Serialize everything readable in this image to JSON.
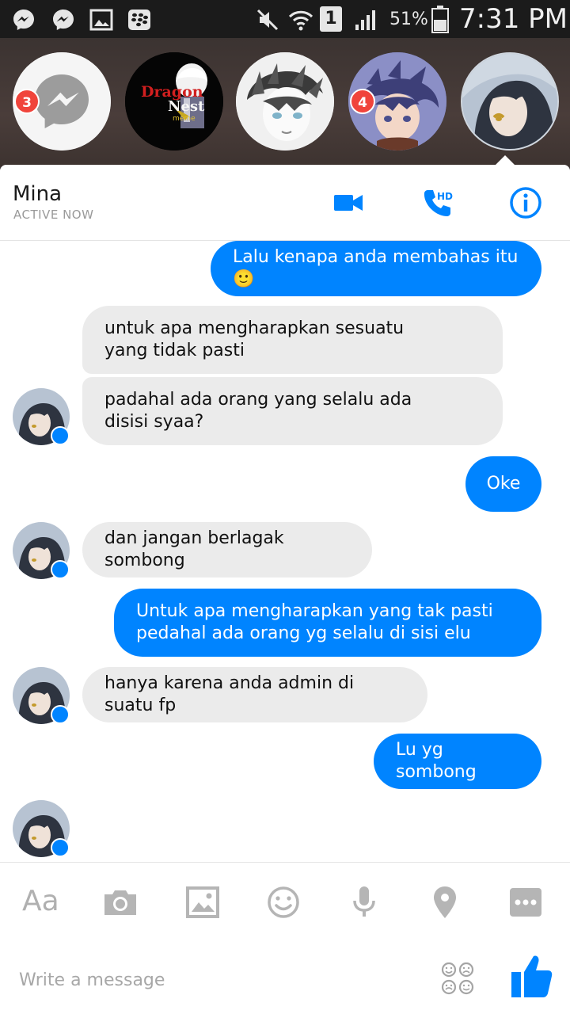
{
  "status_bar": {
    "battery": "51%",
    "time": "7:31 PM",
    "sim_slot": "1"
  },
  "chat_heads": [
    {
      "name": "messenger-head",
      "badge": "3"
    },
    {
      "name": "dragon-nest-head",
      "badge": "",
      "logo_text": [
        "Dragon",
        "Nest",
        "meme"
      ]
    },
    {
      "name": "manga-boy-head",
      "badge": ""
    },
    {
      "name": "anime-boy-head",
      "badge": "4"
    },
    {
      "name": "mina-head",
      "badge": ""
    }
  ],
  "header": {
    "name": "Mina",
    "status": "ACTIVE NOW",
    "call_badge": "HD"
  },
  "messages": [
    {
      "dir": "out",
      "text": "Lalu kenapa anda membahas itu 🙂"
    },
    {
      "dir": "in",
      "text": "untuk apa mengharapkan sesuatu yang tidak pasti"
    },
    {
      "dir": "in",
      "text": "padahal ada orang yang selalu ada disisi syaa?"
    },
    {
      "dir": "out",
      "text": "Oke"
    },
    {
      "dir": "in",
      "text": "dan jangan berlagak sombong"
    },
    {
      "dir": "out",
      "text": "Untuk apa mengharapkan yang tak pasti pedahal ada orang yg selalu di sisi elu"
    },
    {
      "dir": "in",
      "text": "hanya karena anda admin di suatu fp"
    },
    {
      "dir": "out",
      "text": "Lu yg sombong"
    },
    {
      "dir": "in",
      "text": "🙂"
    }
  ],
  "composer": {
    "aa_label": "Aa",
    "placeholder": "Write a message",
    "tools": [
      "camera-icon",
      "image-icon",
      "emoji-icon",
      "microphone-icon",
      "location-icon",
      "more-icon"
    ]
  },
  "colors": {
    "accent": "#0084ff",
    "incoming_bubble": "#ebebeb",
    "badge": "#f0443b"
  }
}
